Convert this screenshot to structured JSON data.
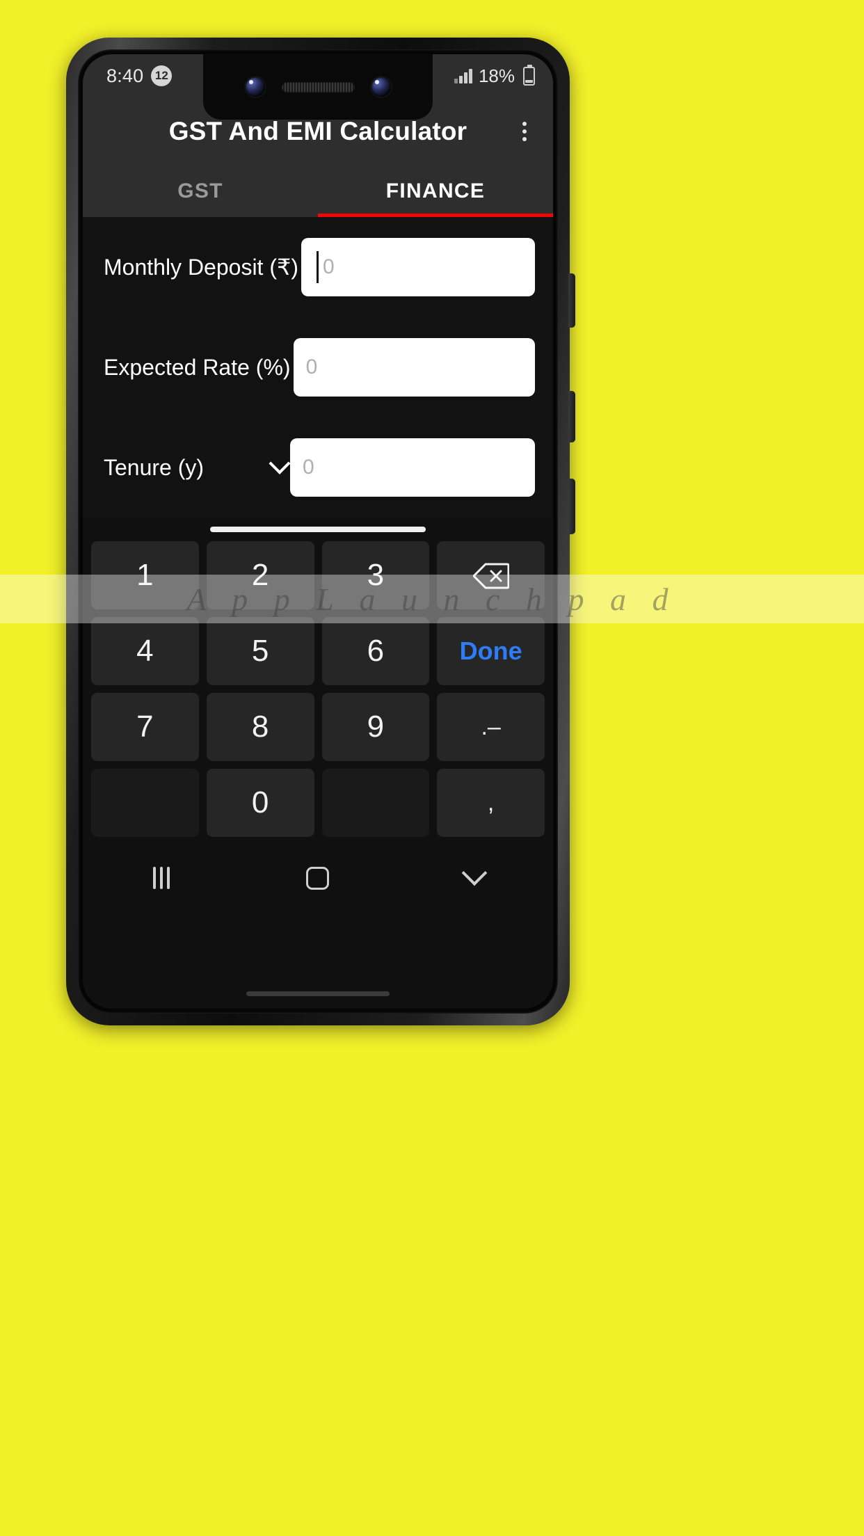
{
  "status_bar": {
    "time": "8:40",
    "notification_count": "12",
    "battery_percent": "18%",
    "signal_icon": "cellular-signal-icon",
    "battery_icon": "battery-icon"
  },
  "app_bar": {
    "title": "GST And EMI Calculator",
    "overflow_icon": "overflow-menu-icon"
  },
  "tabs": [
    {
      "label": "GST",
      "active": false
    },
    {
      "label": "FINANCE",
      "active": true
    }
  ],
  "accent": {
    "tab_indicator": "#f20505",
    "done_key": "#2e7df6",
    "page_background": "#f2f029"
  },
  "form": {
    "fields": [
      {
        "label": "Monthly Deposit (₹)",
        "placeholder": "0",
        "value": "",
        "focused": true,
        "has_dropdown": false
      },
      {
        "label": "Expected Rate (%)",
        "placeholder": "0",
        "value": "",
        "focused": false,
        "has_dropdown": false
      },
      {
        "label": "Tenure (y)",
        "placeholder": "0",
        "value": "",
        "focused": false,
        "has_dropdown": true,
        "dropdown_icon": "chevron-down-icon"
      }
    ]
  },
  "keyboard": {
    "rows": [
      [
        {
          "label": "1",
          "type": "digit"
        },
        {
          "label": "2",
          "type": "digit"
        },
        {
          "label": "3",
          "type": "digit"
        },
        {
          "label": "",
          "type": "backspace",
          "icon": "backspace-icon"
        }
      ],
      [
        {
          "label": "4",
          "type": "digit"
        },
        {
          "label": "5",
          "type": "digit"
        },
        {
          "label": "6",
          "type": "digit"
        },
        {
          "label": "Done",
          "type": "done"
        }
      ],
      [
        {
          "label": "7",
          "type": "digit"
        },
        {
          "label": "8",
          "type": "digit"
        },
        {
          "label": "9",
          "type": "digit"
        },
        {
          "label": ".–",
          "type": "punct"
        }
      ],
      [
        {
          "label": "",
          "type": "blank"
        },
        {
          "label": "0",
          "type": "digit"
        },
        {
          "label": "",
          "type": "blank"
        },
        {
          "label": ",",
          "type": "punct"
        }
      ]
    ]
  },
  "nav_bar": {
    "recents_icon": "recents-icon",
    "home_icon": "home-icon",
    "dismiss_keyboard_icon": "chevron-down-icon"
  },
  "watermark": {
    "text": "A p p L a u n c h p a d"
  }
}
